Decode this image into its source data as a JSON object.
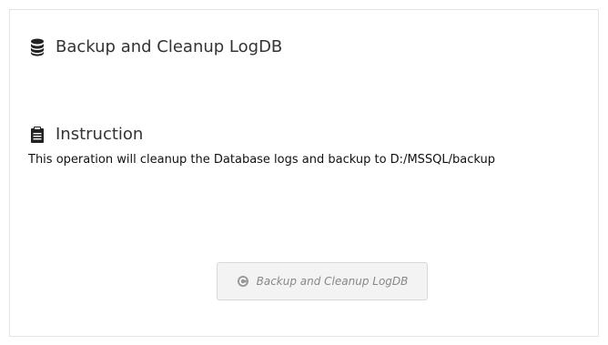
{
  "header": {
    "icon": "database-icon",
    "title": "Backup and Cleanup LogDB"
  },
  "instruction": {
    "icon": "clipboard-icon",
    "title": "Instruction",
    "text": "This operation will cleanup the Database logs and backup to D:/MSSQL/backup"
  },
  "action": {
    "icon": "copyright-circle-icon",
    "label": "Backup and Cleanup LogDB",
    "state": "disabled"
  },
  "colors": {
    "text": "#333333",
    "button_bg": "#f3f3f3",
    "button_text": "#888888",
    "border": "#e3e3e3"
  }
}
